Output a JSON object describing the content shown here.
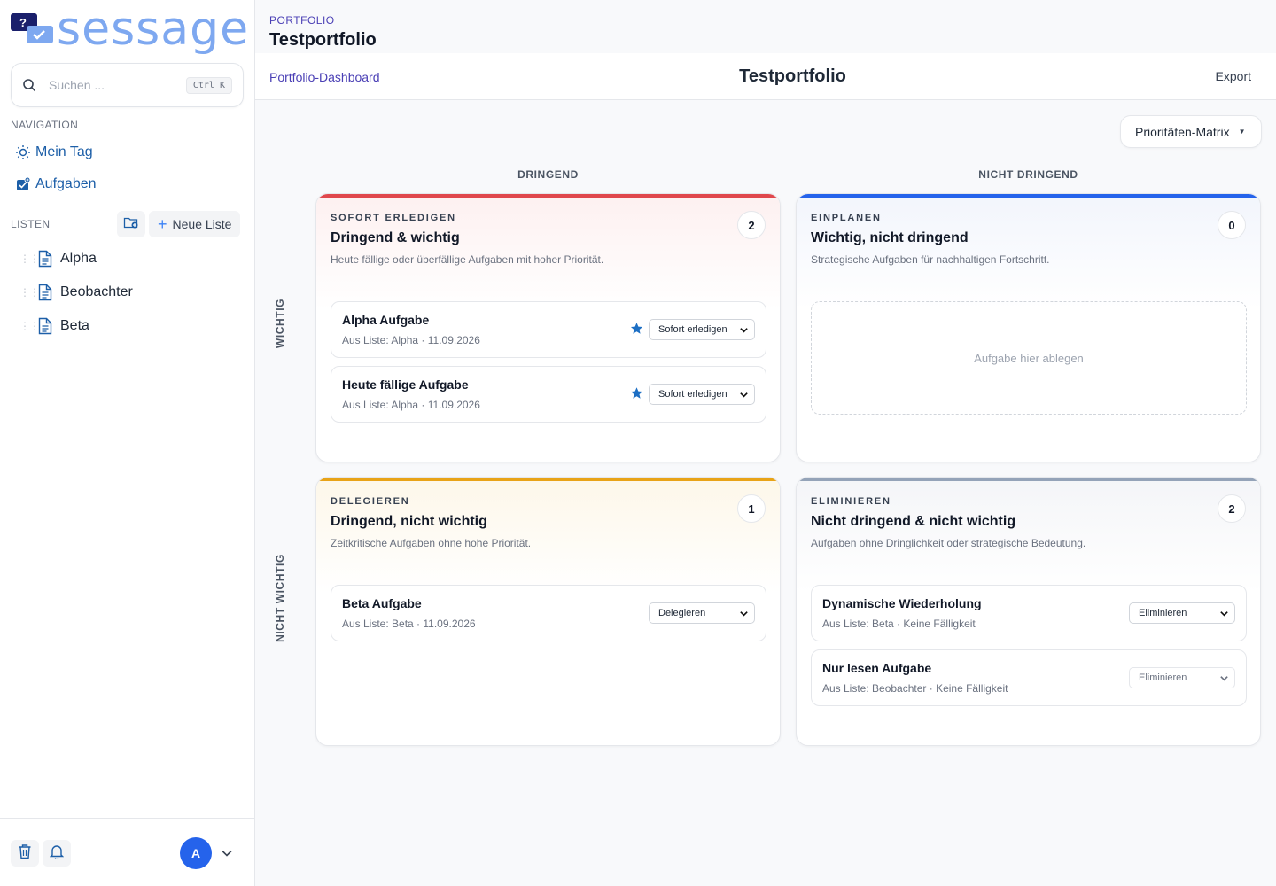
{
  "app": {
    "logo_text": "sessage"
  },
  "search": {
    "placeholder": "Suchen ...",
    "shortcut": "Ctrl K"
  },
  "sidebar": {
    "navigation_label": "NAVIGATION",
    "nav": [
      {
        "label": "Mein Tag",
        "icon": "sun-icon"
      },
      {
        "label": "Aufgaben",
        "icon": "tasks-icon"
      }
    ],
    "lists_label": "LISTEN",
    "new_list_label": "Neue Liste",
    "lists": [
      {
        "label": "Alpha"
      },
      {
        "label": "Beobachter"
      },
      {
        "label": "Beta"
      }
    ]
  },
  "user": {
    "avatar_initial": "A"
  },
  "header": {
    "breadcrumb": "PORTFOLIO",
    "title": "Testportfolio",
    "dashboard_link": "Portfolio-Dashboard",
    "center_title": "Testportfolio",
    "export_label": "Export"
  },
  "view_selector": {
    "value": "Prioritäten-Matrix"
  },
  "matrix": {
    "col_headers": [
      "DRINGEND",
      "NICHT DRINGEND"
    ],
    "row_headers": [
      "WICHTIG",
      "NICHT WICHTIG"
    ],
    "quadrants": [
      {
        "kicker": "SOFORT ERLEDIGEN",
        "title": "Dringend & wichtig",
        "description": "Heute fällige oder überfällige Aufgaben mit hoher Priorität.",
        "count": "2",
        "accent": "#e0474c",
        "tint": "#fdf2f2",
        "tasks": [
          {
            "title": "Alpha Aufgabe",
            "list": "Aus Liste: Alpha",
            "due": "11.09.2026",
            "starred": true,
            "select": "Sofort erledigen"
          },
          {
            "title": "Heute fällige Aufgabe",
            "list": "Aus Liste: Alpha",
            "due": "11.09.2026",
            "starred": true,
            "select": "Sofort erledigen"
          }
        ]
      },
      {
        "kicker": "EINPLANEN",
        "title": "Wichtig, nicht dringend",
        "description": "Strategische Aufgaben für nachhaltigen Fortschritt.",
        "count": "0",
        "accent": "#2563eb",
        "tint": "#f3f6fd",
        "dropzone": "Aufgabe hier ablegen",
        "tasks": []
      },
      {
        "kicker": "DELEGIEREN",
        "title": "Dringend, nicht wichtig",
        "description": "Zeitkritische Aufgaben ohne hohe Priorität.",
        "count": "1",
        "accent": "#e8a317",
        "tint": "#fdf8ec",
        "tasks": [
          {
            "title": "Beta Aufgabe",
            "list": "Aus Liste: Beta",
            "due": "11.09.2026",
            "starred": false,
            "select": "Delegieren"
          }
        ]
      },
      {
        "kicker": "ELIMINIEREN",
        "title": "Nicht dringend & nicht wichtig",
        "description": "Aufgaben ohne Dringlichkeit oder strategische Bedeutung.",
        "count": "2",
        "accent": "#94a3b8",
        "tint": "#f5f6f8",
        "tasks": [
          {
            "title": "Dynamische Wiederholung",
            "list": "Aus Liste: Beta",
            "due": "Keine Fälligkeit",
            "starred": false,
            "select": "Eliminieren"
          },
          {
            "title": "Nur lesen Aufgabe",
            "list": "Aus Liste: Beobachter",
            "due": "Keine Fälligkeit",
            "starred": false,
            "select": "Eliminieren",
            "disabled": true
          }
        ]
      }
    ]
  }
}
